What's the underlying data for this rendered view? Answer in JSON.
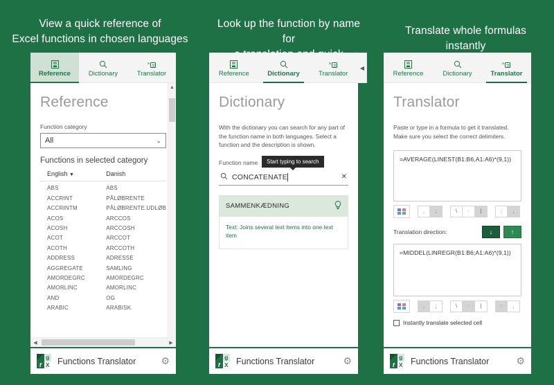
{
  "background_color": "#1e7145",
  "brand": {
    "name": "Functions Translator",
    "logo_cells": {
      "top_right": "g",
      "bottom_left": "f",
      "bottom_right": "X"
    },
    "settings_icon": "gear-icon"
  },
  "panels": [
    {
      "caption": [
        "View a quick reference of",
        "Excel functions in chosen languages"
      ],
      "tabs": [
        {
          "label": "Reference",
          "icon": "book-icon",
          "active": true
        },
        {
          "label": "Dictionary",
          "icon": "magnifier-icon",
          "active": false
        },
        {
          "label": "Translator",
          "icon": "translate-icon",
          "active": false
        }
      ],
      "title": "Reference",
      "category_label": "Function category",
      "category_value": "All",
      "section_head": "Functions in selected category",
      "columns": [
        "English",
        "Danish"
      ],
      "rows": [
        [
          "ABS",
          "ABS"
        ],
        [
          "ACCRINT",
          "PÅLØBRENTE"
        ],
        [
          "ACCRINTM",
          "PÅLØBRENTE.UDLØB"
        ],
        [
          "ACOS",
          "ARCCOS"
        ],
        [
          "ACOSH",
          "ARCCOSH"
        ],
        [
          "ACOT",
          "ARCCOT"
        ],
        [
          "ACOTH",
          "ARCCOTH"
        ],
        [
          "ADDRESS",
          "ADRESSE"
        ],
        [
          "AGGREGATE",
          "SAMLING"
        ],
        [
          "AMORDEGRC",
          "AMORDEGRC"
        ],
        [
          "AMORLINC",
          "AMORLINC"
        ],
        [
          "AND",
          "OG"
        ],
        [
          "ARABIC",
          "ARABISK"
        ]
      ]
    },
    {
      "caption": [
        "Look up the function by name for",
        "a translation and quick summary"
      ],
      "tabs": [
        {
          "label": "Reference",
          "icon": "book-icon",
          "active": false
        },
        {
          "label": "Dictionary",
          "icon": "magnifier-icon",
          "active": true
        },
        {
          "label": "Translator",
          "icon": "translate-icon",
          "active": false
        }
      ],
      "title": "Dictionary",
      "intro": "With the dictionary you can search for any part of the function name in both languages. Select a function and the description is shown.",
      "search_label": "Function name",
      "tooltip": "Start typing to search",
      "search_value": "CONCATENATE",
      "search_placeholder": "Start typing to search",
      "result": {
        "name": "SAMMENKÆDNING",
        "description": "Text: Joins several text items into one text item"
      }
    },
    {
      "caption": [
        "Translate whole formulas instantly"
      ],
      "tabs": [
        {
          "label": "Reference",
          "icon": "book-icon",
          "active": false
        },
        {
          "label": "Dictionary",
          "icon": "magnifier-icon",
          "active": false
        },
        {
          "label": "Translator",
          "icon": "translate-icon",
          "active": true
        }
      ],
      "title": "Translator",
      "intro": "Paste or type in a formula to get it translated. Make sure you select the correct delimiters.",
      "source_formula": "=AVERAGE(LINEST(B1:B6,A1:A6)*(9,1))",
      "target_formula": "=MIDDEL(LINREGR(B1:B6;A1:A6)*(9,1))",
      "delimiters_top": [
        {
          "glyph": ",",
          "selected": false
        },
        {
          "glyph": ";",
          "selected": true
        },
        {
          "glyph": "\\",
          "selected": false
        },
        {
          "glyph": "·",
          "selected": false
        },
        {
          "glyph": "|",
          "selected": true
        },
        {
          "glyph": ":",
          "selected": false
        },
        {
          "glyph": ",",
          "selected": true
        }
      ],
      "delimiters_bottom": [
        {
          "glyph": ",",
          "selected": true
        },
        {
          "glyph": ";",
          "selected": false
        },
        {
          "glyph": "\\",
          "selected": false
        },
        {
          "glyph": "·",
          "selected": true
        },
        {
          "glyph": "|",
          "selected": false
        },
        {
          "glyph": ":",
          "selected": true
        },
        {
          "glyph": ",",
          "selected": false
        }
      ],
      "direction_label": "Translation direction:",
      "direction_down": "↓",
      "direction_up": "↑",
      "checkbox_label": "Instantly translate selected cell",
      "checkbox_checked": false
    }
  ]
}
